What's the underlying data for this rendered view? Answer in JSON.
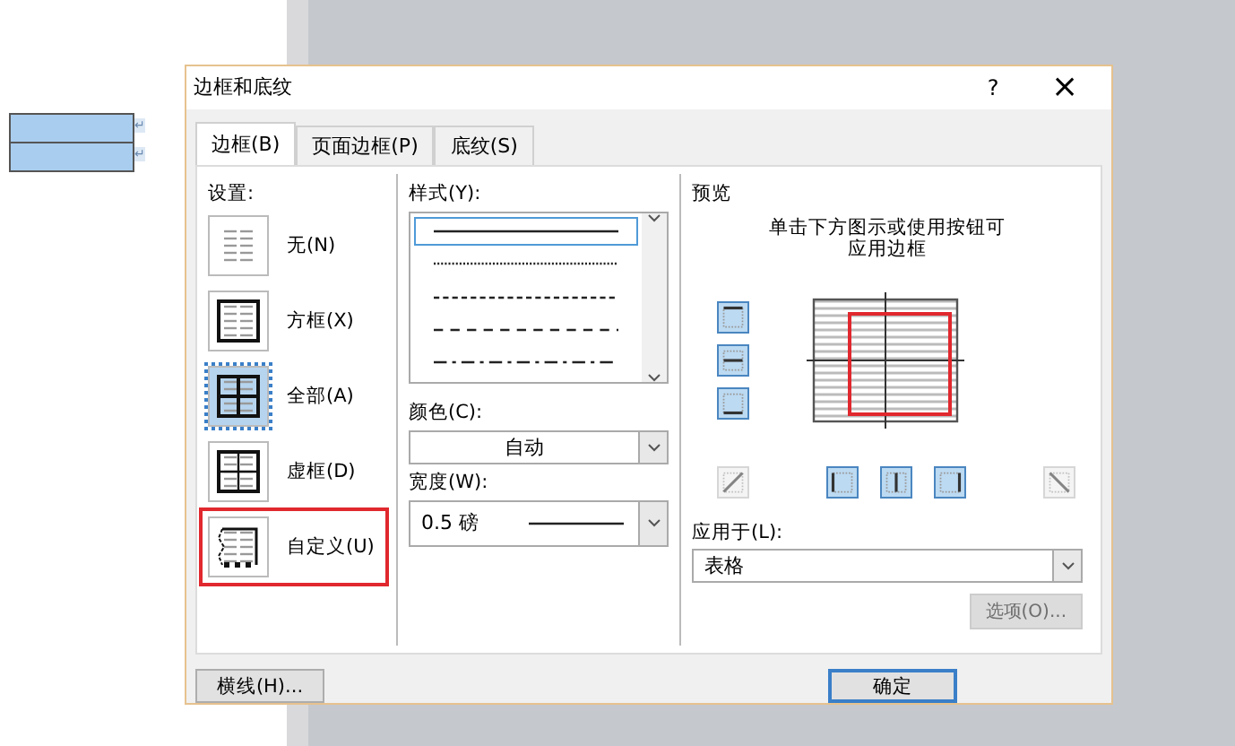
{
  "document": {
    "table_rows": [
      {
        "mark": "↵"
      },
      {
        "mark": "↵"
      }
    ]
  },
  "dialog": {
    "title": "边框和底纹",
    "help": "?",
    "close": "×",
    "tabs": [
      {
        "label": "边框(B)",
        "selected": true
      },
      {
        "label": "页面边框(P)",
        "selected": false
      },
      {
        "label": "底纹(S)",
        "selected": false
      }
    ],
    "settings": {
      "label": "设置:",
      "items": [
        {
          "label": "无(N)",
          "kind": "none",
          "selected": false,
          "highlighted": false
        },
        {
          "label": "方框(X)",
          "kind": "box",
          "selected": false,
          "highlighted": false
        },
        {
          "label": "全部(A)",
          "kind": "all",
          "selected": true,
          "highlighted": false
        },
        {
          "label": "虚框(D)",
          "kind": "grid",
          "selected": false,
          "highlighted": false
        },
        {
          "label": "自定义(U)",
          "kind": "custom",
          "selected": false,
          "highlighted": true
        }
      ]
    },
    "style": {
      "label": "样式(Y):",
      "lines": [
        {
          "kind": "solid",
          "selected": true
        },
        {
          "kind": "dotted",
          "selected": false
        },
        {
          "kind": "dashed",
          "selected": false
        },
        {
          "kind": "wide-dashed",
          "selected": false
        },
        {
          "kind": "dash-dot",
          "selected": false
        }
      ]
    },
    "color": {
      "label": "颜色(C):",
      "value": "自动"
    },
    "width": {
      "label": "宽度(W):",
      "value": "0.5 磅"
    },
    "preview": {
      "label": "预览",
      "hint": "单击下方图示或使用按钮可应用边框",
      "side_buttons": [
        {
          "kind": "top",
          "selected": true
        },
        {
          "kind": "middle",
          "selected": true
        },
        {
          "kind": "bottom",
          "selected": true
        }
      ],
      "bottom_buttons": [
        {
          "kind": "diag-up",
          "selected": false,
          "disabled": true
        },
        {
          "kind": "left",
          "selected": true,
          "disabled": false
        },
        {
          "kind": "center",
          "selected": true,
          "disabled": false
        },
        {
          "kind": "right",
          "selected": true,
          "disabled": false
        },
        {
          "kind": "diag-down",
          "selected": false,
          "disabled": true
        }
      ],
      "highlighted": true
    },
    "apply_to": {
      "label": "应用于(L):",
      "value": "表格"
    },
    "options_button": {
      "label": "选项(O)...",
      "disabled": true
    },
    "buttons": [
      {
        "label": "横线(H)...",
        "kind": "left"
      },
      {
        "label": "确定",
        "kind": "default"
      }
    ]
  }
}
